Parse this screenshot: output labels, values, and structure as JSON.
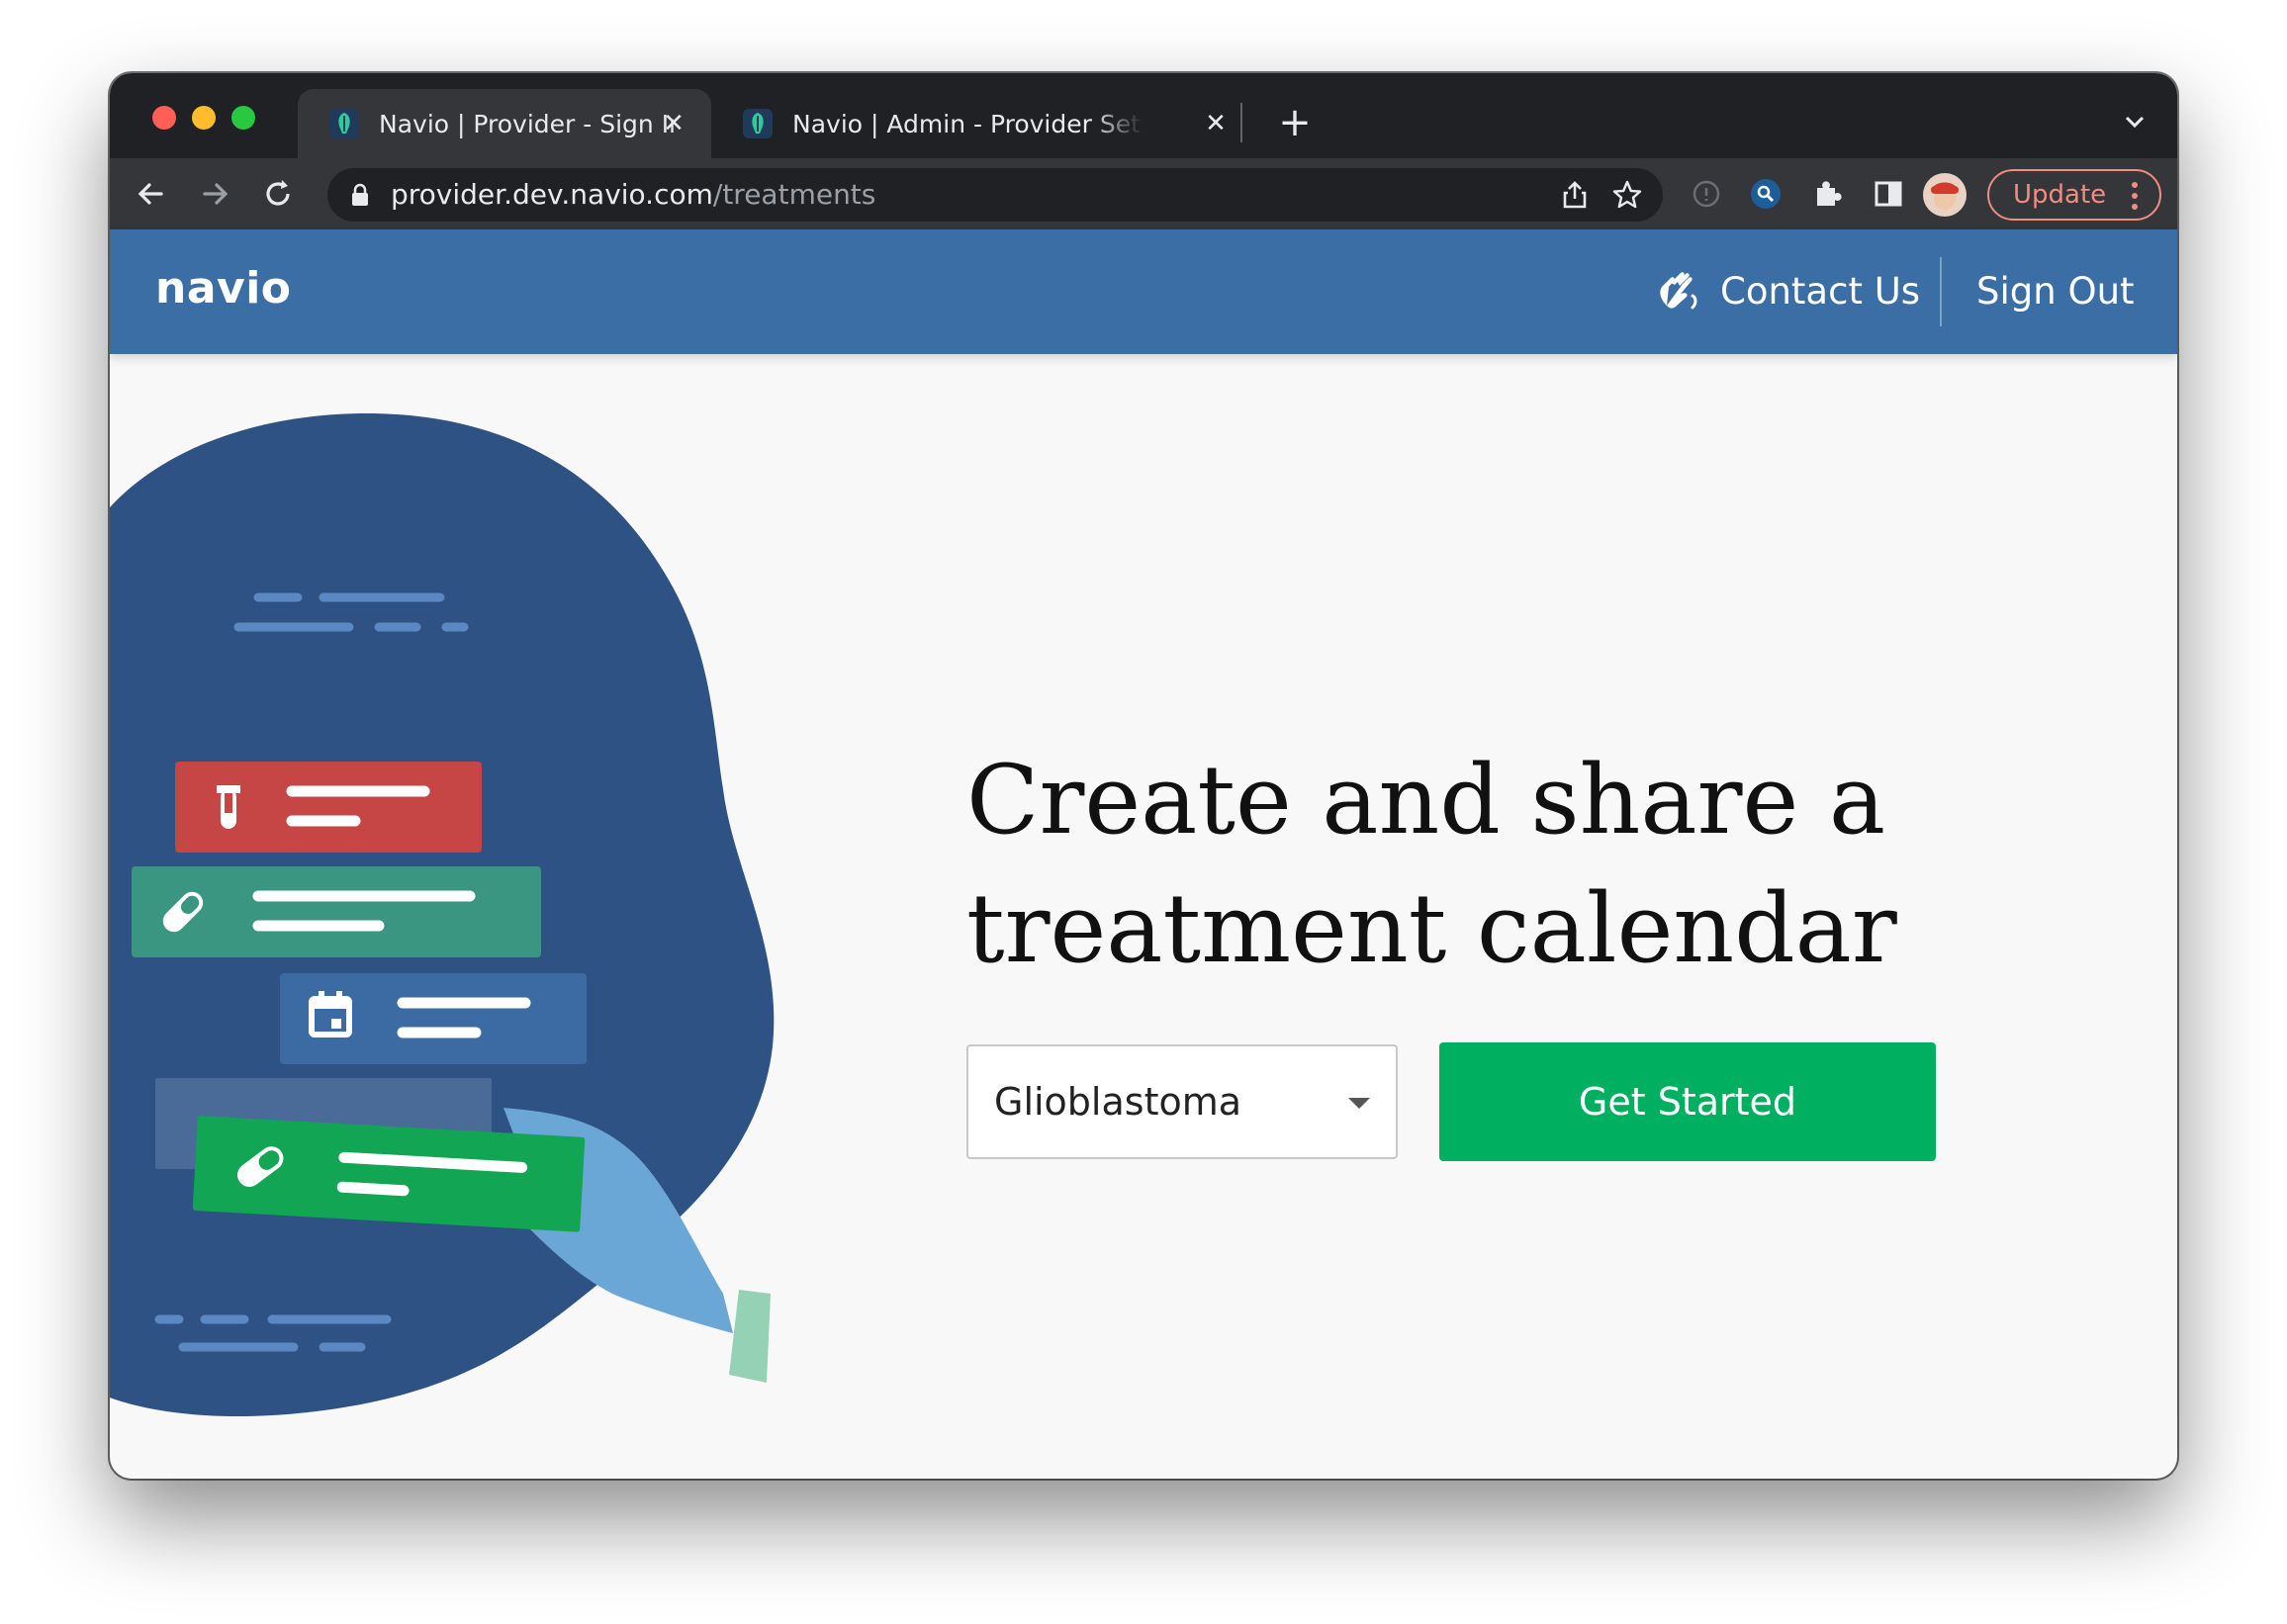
{
  "browser": {
    "tabs": [
      {
        "title": "Navio | Provider - Sign In",
        "active": true
      },
      {
        "title": "Navio | Admin - Provider Settings",
        "active": false
      }
    ],
    "url_host": "provider.dev.navio.com",
    "url_path": "/treatments",
    "update_label": "Update"
  },
  "header": {
    "logo": "navio",
    "contact_label": "Contact Us",
    "signout_label": "Sign Out"
  },
  "hero": {
    "headline_line1": "Create and share a",
    "headline_line2": "treatment calendar",
    "condition_select_value": "Glioblastoma",
    "cta_label": "Get Started"
  },
  "colors": {
    "header_blue": "#3a6ea5",
    "cta_green": "#00b060",
    "blob_navy": "#2d5283",
    "card_red": "#c64545",
    "card_teal": "#3a9681",
    "card_blue": "#3c6aa3",
    "card_green": "#11a554",
    "hand_blue": "#6aa6d6"
  },
  "icons": {
    "contact": "waving-hand-icon",
    "test_tube": "test-tube-icon",
    "pill": "pill-icon",
    "calendar": "calendar-icon"
  }
}
